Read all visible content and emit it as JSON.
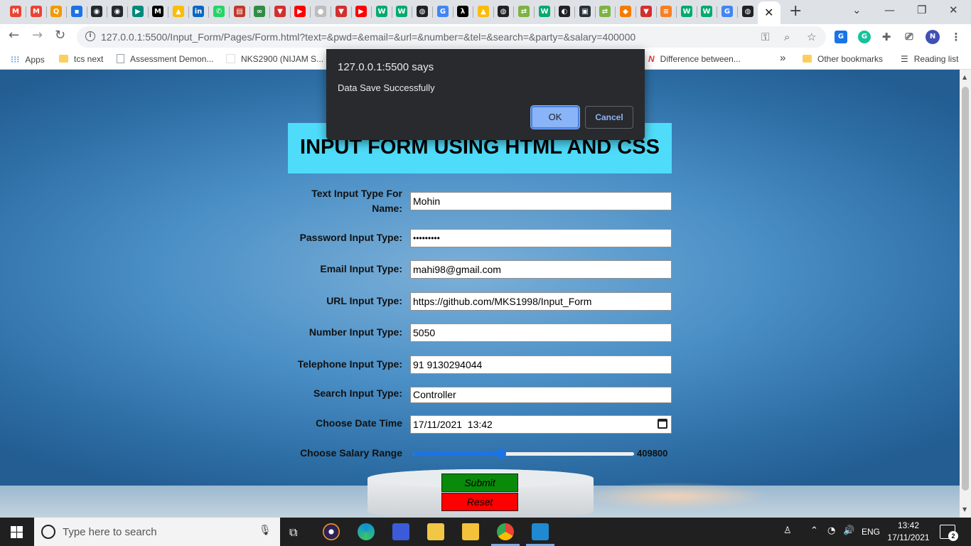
{
  "browser": {
    "tabs_favicons": [
      {
        "icon": "gmail-icon",
        "color": "#ea4335",
        "glyph": "M"
      },
      {
        "icon": "gmail-icon",
        "color": "#ea4335",
        "glyph": "M"
      },
      {
        "icon": "q-icon",
        "color": "#f29900",
        "glyph": "Q"
      },
      {
        "icon": "contacts-icon",
        "color": "#1a73e8",
        "glyph": "▪"
      },
      {
        "icon": "github-icon",
        "color": "#24292e",
        "glyph": "◉"
      },
      {
        "icon": "github-icon",
        "color": "#24292e",
        "glyph": "◉"
      },
      {
        "icon": "meet-icon",
        "color": "#00897b",
        "glyph": "▶"
      },
      {
        "icon": "medium-icon",
        "color": "#000000",
        "glyph": "M"
      },
      {
        "icon": "drive-icon",
        "color": "#fbbc04",
        "glyph": "▲"
      },
      {
        "icon": "linkedin-icon",
        "color": "#0a66c2",
        "glyph": "in"
      },
      {
        "icon": "whatsapp-icon",
        "color": "#25d366",
        "glyph": "✆"
      },
      {
        "icon": "card-icon",
        "color": "#c0392b",
        "glyph": "▤"
      },
      {
        "icon": "gfg-icon",
        "color": "#2f8d46",
        "glyph": "∞"
      },
      {
        "icon": "vercel-icon",
        "color": "#d32f2f",
        "glyph": "▼"
      },
      {
        "icon": "youtube-icon",
        "color": "#ff0000",
        "glyph": "▶"
      },
      {
        "icon": "emblem-icon",
        "color": "#bdbdbd",
        "glyph": "●"
      },
      {
        "icon": "vercel-icon",
        "color": "#d32f2f",
        "glyph": "▼"
      },
      {
        "icon": "youtube-icon",
        "color": "#ff0000",
        "glyph": "▶"
      },
      {
        "icon": "w3-icon",
        "color": "#04aa6d",
        "glyph": "W"
      },
      {
        "icon": "w3-icon",
        "color": "#04aa6d",
        "glyph": "W"
      },
      {
        "icon": "globe-icon",
        "color": "#202124",
        "glyph": "◍"
      },
      {
        "icon": "google-icon",
        "color": "#4285f4",
        "glyph": "G"
      },
      {
        "icon": "code-icon",
        "color": "#000000",
        "glyph": "λ"
      },
      {
        "icon": "drive-icon",
        "color": "#fbbc04",
        "glyph": "▲"
      },
      {
        "icon": "globe-icon",
        "color": "#202124",
        "glyph": "◍"
      },
      {
        "icon": "arrows-icon",
        "color": "#7cb342",
        "glyph": "⇄"
      },
      {
        "icon": "w3-icon",
        "color": "#04aa6d",
        "glyph": "W"
      },
      {
        "icon": "codepen-icon",
        "color": "#202124",
        "glyph": "◐"
      },
      {
        "icon": "terminal-icon",
        "color": "#263238",
        "glyph": "▣"
      },
      {
        "icon": "arrows-icon",
        "color": "#7cb342",
        "glyph": "⇄"
      },
      {
        "icon": "cube-icon",
        "color": "#f57c00",
        "glyph": "◆"
      },
      {
        "icon": "vercel-icon",
        "color": "#d32f2f",
        "glyph": "▼"
      },
      {
        "icon": "stackoverflow-icon",
        "color": "#f48024",
        "glyph": "≡"
      },
      {
        "icon": "w3-icon",
        "color": "#04aa6d",
        "glyph": "W"
      },
      {
        "icon": "w3-icon",
        "color": "#04aa6d",
        "glyph": "W"
      },
      {
        "icon": "google-icon",
        "color": "#4285f4",
        "glyph": "G"
      },
      {
        "icon": "globe-icon",
        "color": "#202124",
        "glyph": "◍"
      }
    ],
    "active_tab_close": "✕",
    "new_tab": "+",
    "url": "127.0.0.1:5500/Input_Form/Pages/Form.html?text=&pwd=&email=&url=&number=&tel=&search=&party=&salary=400000",
    "bookmarks": {
      "apps": "Apps",
      "tcs": "tcs next",
      "assessment": "Assessment Demon...",
      "nks": "NKS2900 (NIJAM S...",
      "difference": "Difference between...",
      "more": "»",
      "other": "Other bookmarks",
      "reading": "Reading list"
    },
    "profile_initial": "N"
  },
  "dialog": {
    "title": "127.0.0.1:5500 says",
    "message": "Data Save Successfully",
    "ok_label": "OK",
    "cancel_label": "Cancel"
  },
  "form": {
    "title": "INPUT FORM USING HTML AND CSS",
    "fields": {
      "name": {
        "label_line1": "Text Input Type For",
        "label_line2": "Name:",
        "value": "Mohin"
      },
      "password": {
        "label": "Password Input Type:",
        "value": "•••••••••"
      },
      "email": {
        "label": "Email Input Type:",
        "value": "mahi98@gmail.com"
      },
      "url": {
        "label": "URL Input Type:",
        "value": "https://github.com/MKS1998/Input_Form"
      },
      "number": {
        "label": "Number Input Type:",
        "value": "5050"
      },
      "tel": {
        "label": "Telephone Input Type:",
        "value": "91 9130294044"
      },
      "search": {
        "label": "Search Input Type:",
        "value": "Controller"
      },
      "datetime": {
        "label": "Choose Date Time",
        "value": "17/11/2021  13:42"
      },
      "salary": {
        "label": "Choose Salary Range",
        "value": "409800",
        "fill_fraction": 0.4
      }
    },
    "submit_label": "Submit",
    "reset_label": "Reset"
  },
  "taskbar": {
    "search_placeholder": "Type here to search",
    "language": "ENG",
    "time": "13:42",
    "date": "17/11/2021",
    "notification_count": "2"
  }
}
